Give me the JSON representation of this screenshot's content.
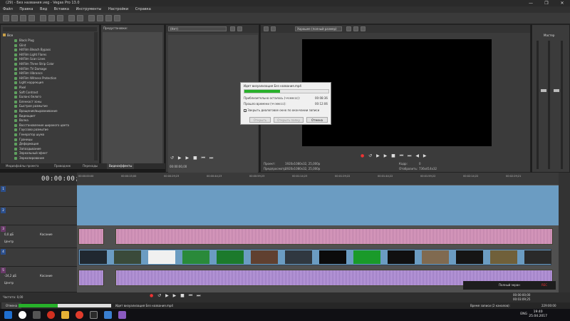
{
  "window": {
    "title": "(29) - Без названия.veg - Vegas Pro 13.0",
    "controls": [
      "—",
      "❐",
      "✕"
    ]
  },
  "menu": [
    "Файл",
    "Правка",
    "Вид",
    "Вставка",
    "Инструменты",
    "Настройки",
    "Справка"
  ],
  "fx_tree": {
    "root": "Все",
    "items": [
      "Black Plug",
      "Glint",
      "HitFilm Bleach Bypass",
      "HitFilm Light Flares",
      "HitFilm Scan Lines",
      "HitFilm Three Strip Color",
      "HitFilm TV Damage",
      "HitFilm Vibrance",
      "HitFilm Witness Protection",
      "Light коррекция",
      "Pixel",
      "Soft Contrast",
      "Баланс белого",
      "Бленкост зоны",
      "Быстрое размытие",
      "Вращение/выравнивание",
      "Видеоцвет",
      "Волна",
      "Восстановление широкого цвета",
      "Гауссово размытие",
      "Генератор шума",
      "Границы",
      "Деформация",
      "Запаздывание",
      "Зеркальный эфект",
      "Зеркалирование"
    ]
  },
  "presets": {
    "header": "Предустановки:"
  },
  "left_tabs": [
    "Медиафайлы проекта",
    "Проводник",
    "Переходы",
    "Видеоэффекты"
  ],
  "trimmer": {
    "selector": "(Нет)",
    "timecode": "00:00:00,00"
  },
  "preview": {
    "quality": "Хорошее (полный размер)",
    "project_label": "Проект:",
    "project_value": "1920x1080x32, 25,000p",
    "preview_label": "Предпросмотр:",
    "preview_value": "1920x1080x32, 25,000p",
    "frame_label": "Кадр:",
    "frame_value": "0",
    "display_label": "Отобразить:",
    "display_value": "736x414x32"
  },
  "master": {
    "title": "Мастер"
  },
  "render_dialog": {
    "title": "Идет визуализация Без названия.mp4",
    "progress_percent": 42,
    "remaining_label": "Приблизительно осталось (чч:мм:сс):",
    "remaining_value": "00:08:36",
    "elapsed_label": "Прошло времени (чч:мм:сс):",
    "elapsed_value": "00:12:06",
    "checkbox_label": "Закрыть диалоговое окно по окончании записи",
    "checkbox_checked": true,
    "buttons": [
      "Открыть",
      "Открыть папку",
      "Отмена"
    ]
  },
  "timeline": {
    "timecode": "00:00:00;00",
    "ruler_marks": [
      "00:00:00:00",
      "00:00:15;00",
      "00:00:29;23",
      "00:00:44;23",
      "00:00:59;23",
      "00:01:14;23",
      "00:01:29;22",
      "00:01:44;22",
      "00:01:59;22",
      "00:02:14;22",
      "00:02:29;21"
    ]
  },
  "tracks": [
    {
      "num": "1",
      "kind": "video"
    },
    {
      "num": "2",
      "kind": "video"
    },
    {
      "num": "3",
      "kind": "audio",
      "volume": "0,0 дБ",
      "mode": "Касание",
      "pan": "Центр"
    },
    {
      "num": "4",
      "kind": "video"
    },
    {
      "num": "5",
      "kind": "audio",
      "volume": "-24,2 дБ",
      "mode": "Касание",
      "pan": "Центр"
    }
  ],
  "bottom": {
    "rate": "Частота: 0,00",
    "right_time": "00:00:00;00",
    "right_time2": "00:03:09;25",
    "preview_label": "Полный экран",
    "rec_label": "REC"
  },
  "status": {
    "left": "Отмена",
    "message": "Идет визуализация Без названия.mp4",
    "right_label": "Время записи (2 каналов):",
    "right_value": "229:00:00"
  },
  "taskbar": {
    "lang": "ENG",
    "time": "19:40",
    "date": "25.04.2017"
  },
  "colors": {
    "progress": "#27b02a",
    "video_track": "#6b9cc2",
    "audio_wave_pink": "#e7a6c8",
    "audio_wave_purple": "#c9a8e8"
  }
}
